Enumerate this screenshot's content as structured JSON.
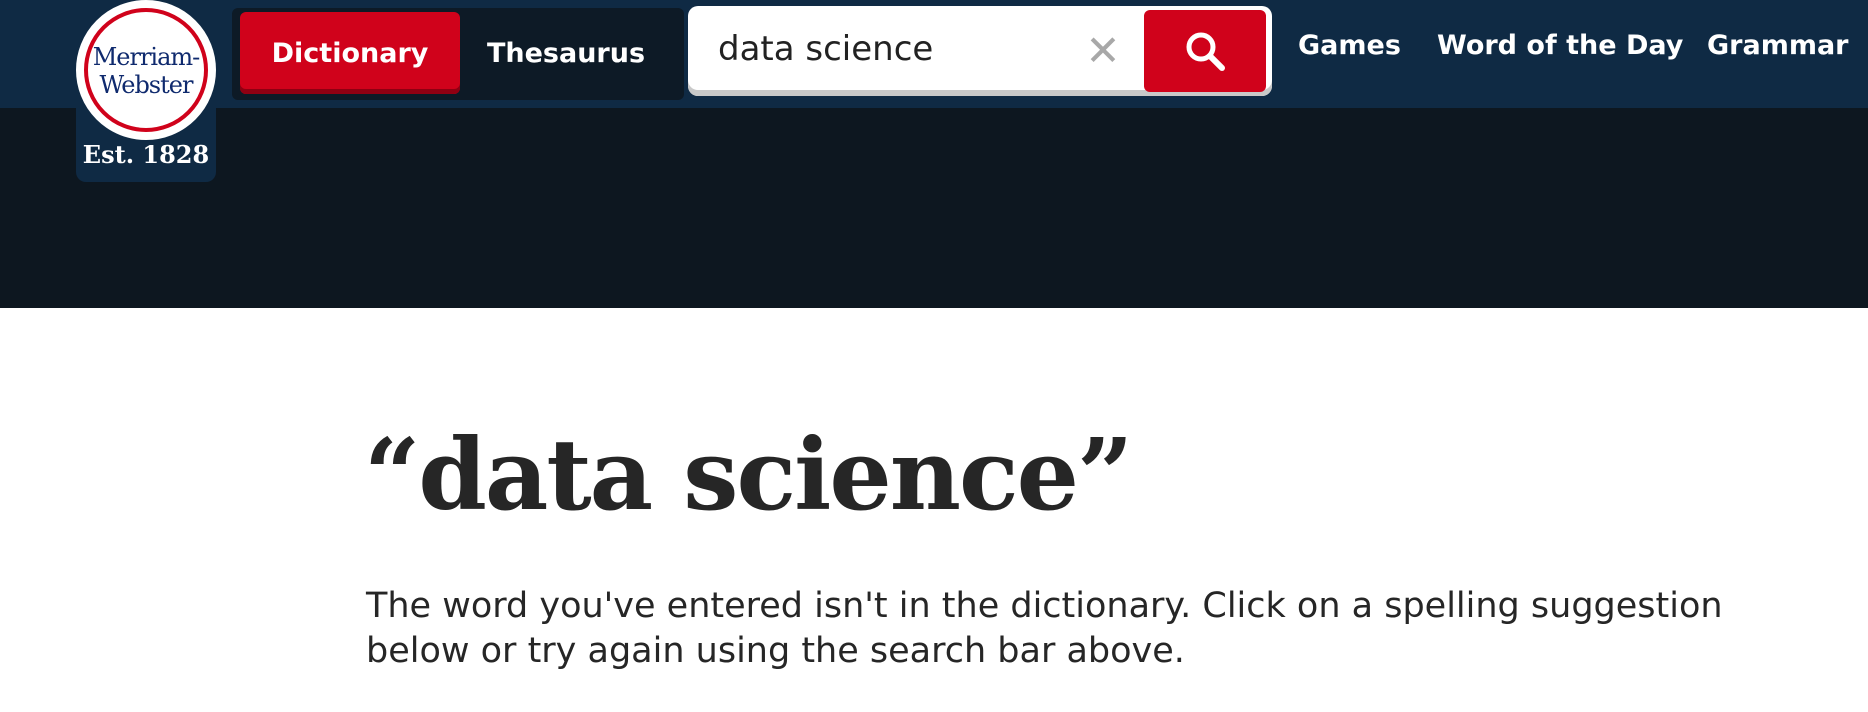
{
  "brand": {
    "logo_line1": "Merriam-",
    "logo_line2": "Webster",
    "established": "Est. 1828",
    "colors": {
      "header": "#0f2a44",
      "band": "#0d1720",
      "accent": "#d0021b"
    }
  },
  "nav": {
    "dictionary_label": "Dictionary",
    "thesaurus_label": "Thesaurus",
    "games_label": "Games",
    "word_of_day_label": "Word of the Day",
    "grammar_label": "Grammar"
  },
  "search": {
    "value": "data science",
    "clear_icon": "close-icon",
    "submit_icon": "search-icon"
  },
  "result": {
    "heading": "“data science”",
    "message": "The word you've entered isn't in the dictionary. Click on a spelling suggestion below or try again using the search bar above."
  }
}
